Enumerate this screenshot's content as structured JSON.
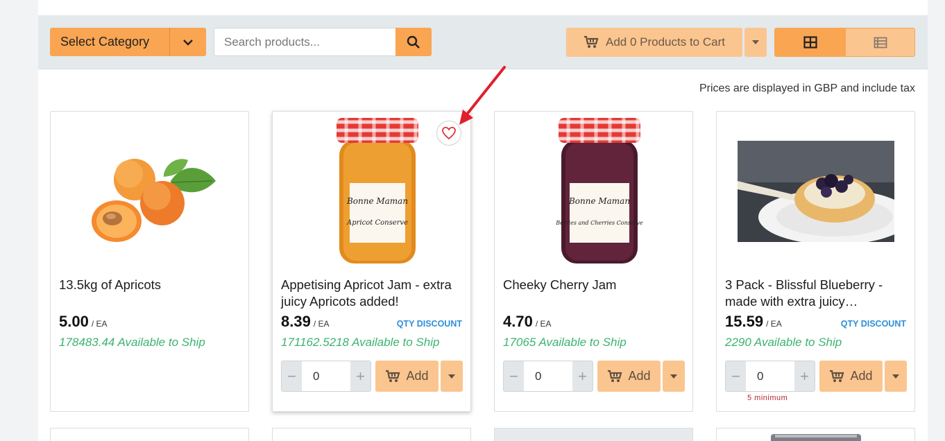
{
  "toolbar": {
    "category_label": "Select Category",
    "search_placeholder": "Search products...",
    "add_to_cart_label": "Add 0 Products to Cart"
  },
  "prices_note": "Prices are displayed in GBP and include tax",
  "products": [
    {
      "name": "13.5kg of Apricots",
      "price": "5.00",
      "unit": "/ EA",
      "availability": "178483.44 Available to Ship"
    },
    {
      "name": "Appetising Apricot Jam - extra juicy Apricots added!",
      "price": "8.39",
      "unit": "/ EA",
      "badge": "QTY DISCOUNT",
      "availability": "171162.5218 Available to Ship",
      "quantity": "0",
      "add_label": "Add",
      "label_brand": "Bonne Maman",
      "label_product": "Apricot Conserve"
    },
    {
      "name": "Cheeky Cherry Jam",
      "price": "4.70",
      "unit": "/ EA",
      "availability": "17065 Available to Ship",
      "quantity": "0",
      "add_label": "Add",
      "label_brand": "Bonne Maman",
      "label_product": "Berries and Cherries Conserve"
    },
    {
      "name": "3 Pack - Blissful Blueberry - made with extra juicy…",
      "price": "15.59",
      "unit": "/ EA",
      "badge": "QTY DISCOUNT",
      "availability": "2290 Available to Ship",
      "quantity": "0",
      "add_label": "Add",
      "min_note": "5 minimum"
    }
  ],
  "colors": {
    "accent": "#f9a552",
    "accent_light": "#fbc590",
    "available_green": "#3cb371",
    "discount_blue": "#2d8fd8",
    "annotation_red": "#e0202c"
  }
}
